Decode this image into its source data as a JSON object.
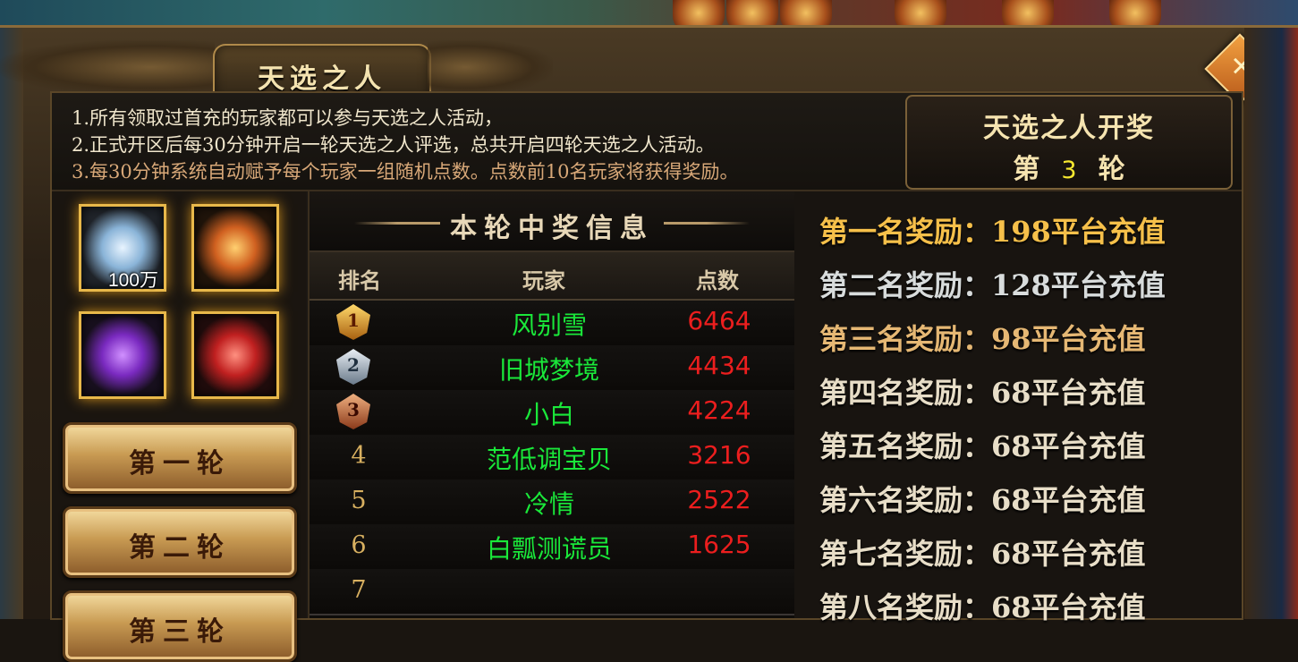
{
  "window": {
    "title": "天选之人",
    "close_icon": "close-icon"
  },
  "rules": [
    "1.所有领取过首充的玩家都可以参与天选之人活动，",
    "2.正式开区后每30分钟开启一轮天选之人评选，总共开启四轮天选之人活动。",
    "3.每30分钟系统自动赋予每个玩家一组随机点数。点数前10名玩家将获得奖励。"
  ],
  "draw": {
    "title": "天选之人开奖",
    "round_prefix": "第",
    "round_number": "3",
    "round_suffix": "轮"
  },
  "rewards": [
    {
      "icon": "diamond-pile-icon",
      "count": "100万"
    },
    {
      "icon": "golden-scroll-icon",
      "count": ""
    },
    {
      "icon": "purple-scroll-icon",
      "count": ""
    },
    {
      "icon": "red-scroll-icon",
      "count": ""
    }
  ],
  "round_buttons": [
    "第一轮",
    "第二轮",
    "第三轮"
  ],
  "winners": {
    "title": "本轮中奖信息",
    "headers": {
      "rank": "排名",
      "player": "玩家",
      "points": "点数"
    },
    "rows": [
      {
        "rank": "1",
        "medal": "gold",
        "player": "风别雪",
        "points": "6464"
      },
      {
        "rank": "2",
        "medal": "silver",
        "player": "旧城梦境",
        "points": "4434"
      },
      {
        "rank": "3",
        "medal": "bronze",
        "player": "小白",
        "points": "4224"
      },
      {
        "rank": "4",
        "player": "范低调宝贝",
        "points": "3216"
      },
      {
        "rank": "5",
        "player": "冷情",
        "points": "2522"
      },
      {
        "rank": "6",
        "player": "白瓢测谎员",
        "points": "1625"
      },
      {
        "rank": "7",
        "player": "",
        "points": ""
      }
    ]
  },
  "prizes": [
    "第一名奖励：198平台充值",
    "第二名奖励：128平台充值",
    "第三名奖励：98平台充值",
    "第四名奖励：68平台充值",
    "第五名奖励：68平台充值",
    "第六名奖励：68平台充值",
    "第七名奖励：68平台充值",
    "第八名奖励：68平台充值"
  ],
  "colors": {
    "player_name": "#1ae83a",
    "points": "#ec1e1e",
    "round_number": "#f6e830",
    "gold": "#f6c04a"
  }
}
